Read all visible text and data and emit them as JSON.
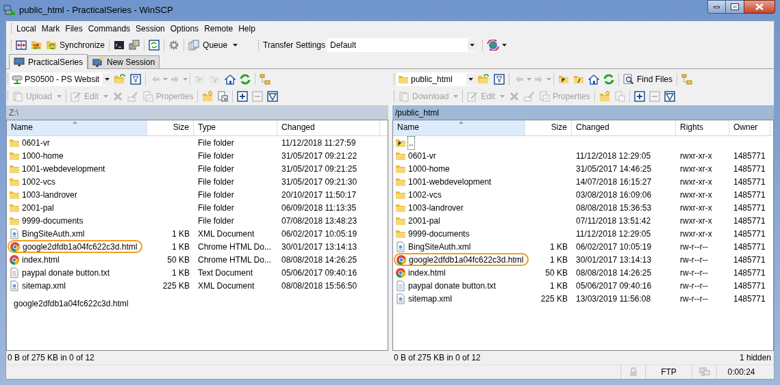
{
  "window": {
    "title": "public_html - PracticalSeries - WinSCP"
  },
  "menu": [
    "Local",
    "Mark",
    "Files",
    "Commands",
    "Session",
    "Options",
    "Remote",
    "Help"
  ],
  "toolbar": {
    "synchronize": "Synchronize",
    "queue": "Queue",
    "transfer_label": "Transfer Settings",
    "transfer_value": "Default"
  },
  "tabs": [
    {
      "label": "PracticalSeries",
      "selected": true
    },
    {
      "label": "New Session",
      "selected": false
    }
  ],
  "panels": [
    {
      "location": "PS0500 - PS Websit",
      "actions": [
        {
          "label": "Upload",
          "disabled": true
        },
        {
          "label": "Edit",
          "disabled": true
        },
        {
          "label": "Properties",
          "disabled": true
        }
      ],
      "path": "Z:\\",
      "active": false,
      "columns": [
        "Name",
        "Size",
        "Type",
        "Changed"
      ],
      "rows": [
        {
          "kind": "folder",
          "cells": [
            "0601-vr",
            null,
            "File folder",
            "11/12/2018  11:27:59"
          ],
          "highlighted": false
        },
        {
          "kind": "folder",
          "cells": [
            "1000-home",
            null,
            "File folder",
            "31/05/2017  09:21:22"
          ],
          "highlighted": false
        },
        {
          "kind": "folder",
          "cells": [
            "1001-webdevelopment",
            null,
            "File folder",
            "31/05/2017  09:21:25"
          ],
          "highlighted": false
        },
        {
          "kind": "folder",
          "cells": [
            "1002-vcs",
            null,
            "File folder",
            "31/05/2017  09:21:30"
          ],
          "highlighted": false
        },
        {
          "kind": "folder",
          "cells": [
            "1003-landrover",
            null,
            "File folder",
            "20/10/2017  11:50:17"
          ],
          "highlighted": false
        },
        {
          "kind": "folder",
          "cells": [
            "2001-pal",
            null,
            "File folder",
            "06/09/2018  11:13:35"
          ],
          "highlighted": false
        },
        {
          "kind": "folder",
          "cells": [
            "9999-documents",
            null,
            "File folder",
            "07/08/2018  13:48:23"
          ],
          "highlighted": false
        },
        {
          "kind": "xml",
          "cells": [
            "BingSiteAuth.xml",
            "1 KB",
            "XML Document",
            "06/02/2017  10:05:19"
          ],
          "highlighted": false
        },
        {
          "kind": "html",
          "cells": [
            "google2dfdb1a04fc622c3d.html",
            "1 KB",
            "Chrome HTML Do...",
            "30/01/2017  13:14:13"
          ],
          "highlighted": true
        },
        {
          "kind": "html",
          "cells": [
            "index.html",
            "50 KB",
            "Chrome HTML Do...",
            "08/08/2018  14:26:25"
          ],
          "highlighted": false
        },
        {
          "kind": "text",
          "cells": [
            "paypal donate button.txt",
            "1 KB",
            "Text Document",
            "05/06/2017  09:40:16"
          ],
          "highlighted": false
        },
        {
          "kind": "xml",
          "cells": [
            "sitemap.xml",
            "225 KB",
            "XML Document",
            "08/08/2018  15:56:50"
          ],
          "highlighted": false
        }
      ],
      "drag_label": "google2dfdb1a04fc622c3d.html",
      "status": "0 B of 275 KB in 0 of 12"
    },
    {
      "location": "public_html",
      "find_files": "Find Files",
      "actions": [
        {
          "label": "Download",
          "disabled": true
        },
        {
          "label": "Edit",
          "disabled": true
        },
        {
          "label": "Properties",
          "disabled": true
        }
      ],
      "path": "/public_html",
      "active": true,
      "columns": [
        "Name",
        "Size",
        "Changed",
        "Rights",
        "Owner"
      ],
      "rows": [
        {
          "kind": "parent",
          "cells": [
            "..",
            null,
            null,
            null,
            null
          ],
          "highlighted": false
        },
        {
          "kind": "folder",
          "cells": [
            "0601-vr",
            null,
            "11/12/2018 12:29:05",
            "rwxr-xr-x",
            "1485771"
          ],
          "highlighted": false
        },
        {
          "kind": "folder",
          "cells": [
            "1000-home",
            null,
            "31/05/2017 14:46:25",
            "rwxr-xr-x",
            "1485771"
          ],
          "highlighted": false
        },
        {
          "kind": "folder",
          "cells": [
            "1001-webdevelopment",
            null,
            "14/07/2018 16:15:27",
            "rwxr-xr-x",
            "1485771"
          ],
          "highlighted": false
        },
        {
          "kind": "folder",
          "cells": [
            "1002-vcs",
            null,
            "03/08/2018 16:09:06",
            "rwxr-xr-x",
            "1485771"
          ],
          "highlighted": false
        },
        {
          "kind": "folder",
          "cells": [
            "1003-landrover",
            null,
            "08/08/2018 15:36:53",
            "rwxr-xr-x",
            "1485771"
          ],
          "highlighted": false
        },
        {
          "kind": "folder",
          "cells": [
            "2001-pal",
            null,
            "07/11/2018 13:51:42",
            "rwxr-xr-x",
            "1485771"
          ],
          "highlighted": false
        },
        {
          "kind": "folder",
          "cells": [
            "9999-documents",
            null,
            "11/12/2018 12:29:05",
            "rwxr-xr-x",
            "1485771"
          ],
          "highlighted": false
        },
        {
          "kind": "xml",
          "cells": [
            "BingSiteAuth.xml",
            "1 KB",
            "06/02/2017 10:05:19",
            "rw-r--r--",
            "1485771"
          ],
          "highlighted": false
        },
        {
          "kind": "html",
          "cells": [
            "google2dfdb1a04fc622c3d.html",
            "1 KB",
            "30/01/2017 13:14:13",
            "rw-r--r--",
            "1485771"
          ],
          "highlighted": true
        },
        {
          "kind": "html",
          "cells": [
            "index.html",
            "50 KB",
            "08/08/2018 14:26:25",
            "rw-r--r--",
            "1485771"
          ],
          "highlighted": false
        },
        {
          "kind": "text",
          "cells": [
            "paypal donate button.txt",
            "1 KB",
            "05/06/2017 09:40:16",
            "rw-r--r--",
            "1485771"
          ],
          "highlighted": false
        },
        {
          "kind": "xml",
          "cells": [
            "sitemap.xml",
            "225 KB",
            "13/03/2019 11:56:08",
            "rw-r--r--",
            "1485771"
          ],
          "highlighted": false
        }
      ],
      "status": "0 B of 275 KB in 0 of 12",
      "hidden": "1 hidden"
    }
  ],
  "status_bar": {
    "protocol": "FTP",
    "time": "0:00:24"
  }
}
